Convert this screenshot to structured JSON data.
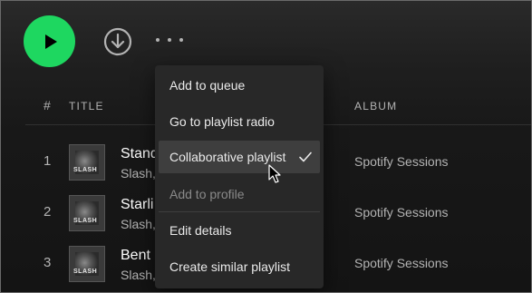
{
  "controls": {
    "play_icon": "play-icon",
    "download_icon": "download-circle-icon",
    "more_icon": "more-horizontal-icon"
  },
  "table": {
    "headers": {
      "number": "#",
      "title": "TITLE",
      "album": "ALBUM"
    },
    "rows": [
      {
        "number": "1",
        "title": "Stand",
        "artist": "Slash, .",
        "album": "Spotify Sessions",
        "thumb_text": "SLASH"
      },
      {
        "number": "2",
        "title": "Starli",
        "artist": "Slash, .",
        "album": "Spotify Sessions",
        "thumb_text": "SLASH"
      },
      {
        "number": "3",
        "title": "Bent",
        "artist": "Slash, .",
        "album": "Spotify Sessions",
        "thumb_text": "SLASH"
      }
    ]
  },
  "context_menu": {
    "items": [
      {
        "label": "Add to queue",
        "state": "normal"
      },
      {
        "label": "Go to playlist radio",
        "state": "normal"
      },
      {
        "label": "Collaborative playlist",
        "state": "checked"
      },
      {
        "label": "Add to profile",
        "state": "disabled"
      },
      {
        "label": "Edit details",
        "state": "normal"
      },
      {
        "label": "Create similar playlist",
        "state": "normal"
      }
    ]
  },
  "colors": {
    "accent": "#1ed760",
    "menu_bg": "#282828",
    "menu_hover": "#3e3e3e",
    "text_primary": "#ffffff",
    "text_secondary": "#b3b3b3"
  }
}
